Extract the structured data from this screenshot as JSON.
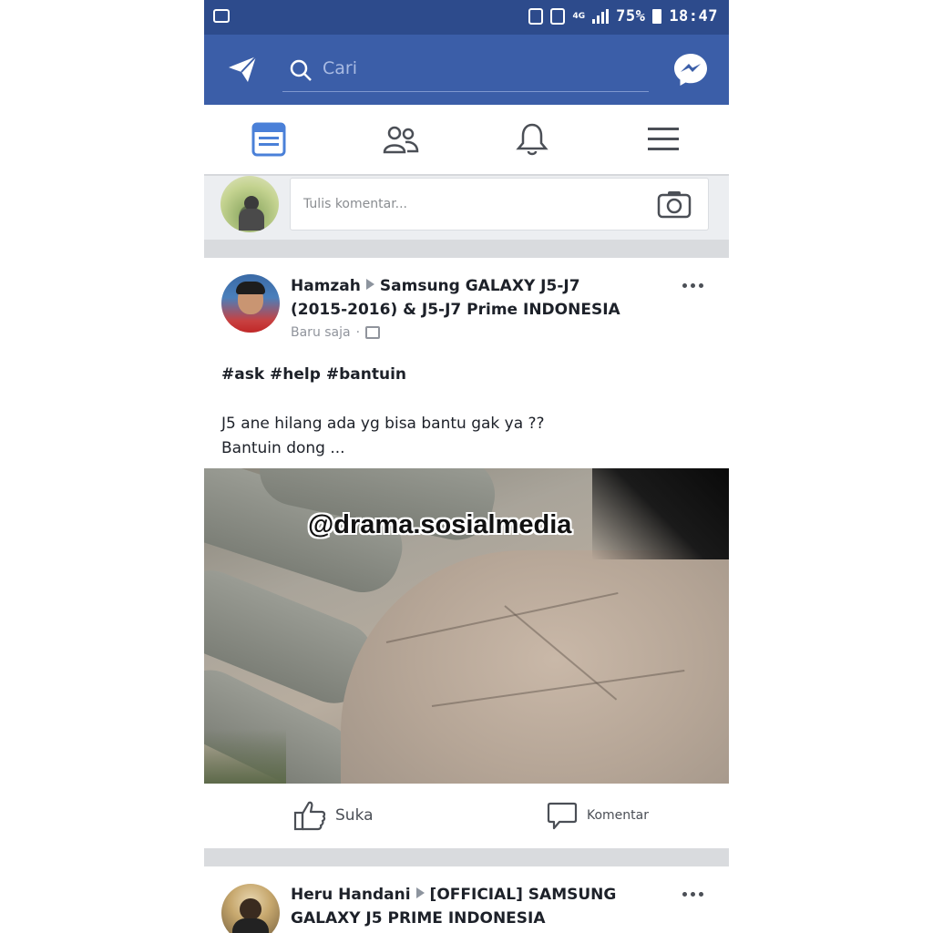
{
  "status_bar": {
    "network": "4G",
    "battery": "75%",
    "time": "18:47"
  },
  "header": {
    "search_placeholder": "Cari"
  },
  "composer": {
    "placeholder": "Tulis komentar..."
  },
  "post": {
    "author": "Hamzah",
    "group": "Samsung GALAXY J5-J7 (2015-2016) & J5-J7 Prime INDONESIA",
    "time": "Baru saja",
    "tags": "#ask #help #bantuin",
    "line1": "J5 ane hilang ada yg bisa bantu gak ya ??",
    "line2": "Bantuin dong ...",
    "watermark": "@drama.sosialmedia",
    "like_label": "Suka",
    "comment_label": "Komentar"
  },
  "post2": {
    "author": "Heru Handani",
    "group": "[OFFICIAL] SAMSUNG GALAXY J5 PRIME INDONESIA"
  },
  "colors": {
    "facebook_blue": "#3b5ea8",
    "status_bar": "#2d4b8c",
    "active_tab": "#4a80d8"
  },
  "icons": {
    "status_left": "message-icon",
    "plane": "paper-plane-icon",
    "search": "search-icon",
    "messenger": "messenger-icon",
    "tab_feed": "news-feed-icon",
    "tab_friends": "friends-icon",
    "tab_notifications": "bell-icon",
    "tab_menu": "menu-icon",
    "camera": "camera-icon",
    "like": "thumbs-up-icon",
    "comment": "comment-icon"
  }
}
